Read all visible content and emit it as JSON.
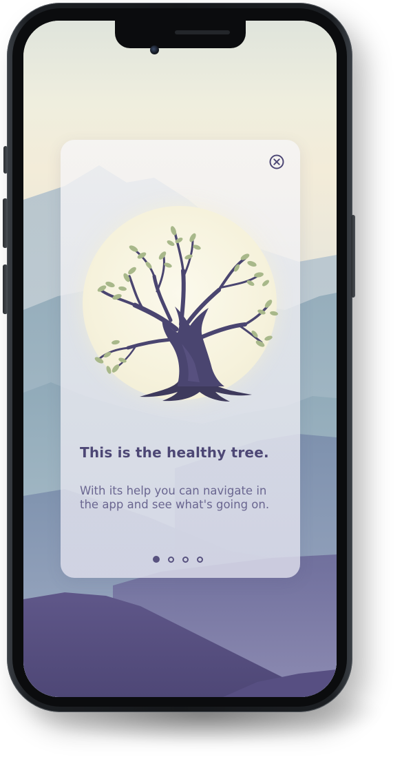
{
  "onboarding": {
    "title": "This is the healthy tree.",
    "description": "With its help you can navigate in the app and see what's going on.",
    "close_icon": "close-circle-icon",
    "illustration": "tree-icon",
    "pagination": {
      "total": 4,
      "current": 1
    }
  },
  "colors": {
    "title": "#4d4775",
    "body": "#6a6690",
    "accent": "#58527f",
    "sky_top": "#dfe4dc",
    "sky_warm": "#f3ecd9",
    "mountain_front": "#5c5585"
  }
}
